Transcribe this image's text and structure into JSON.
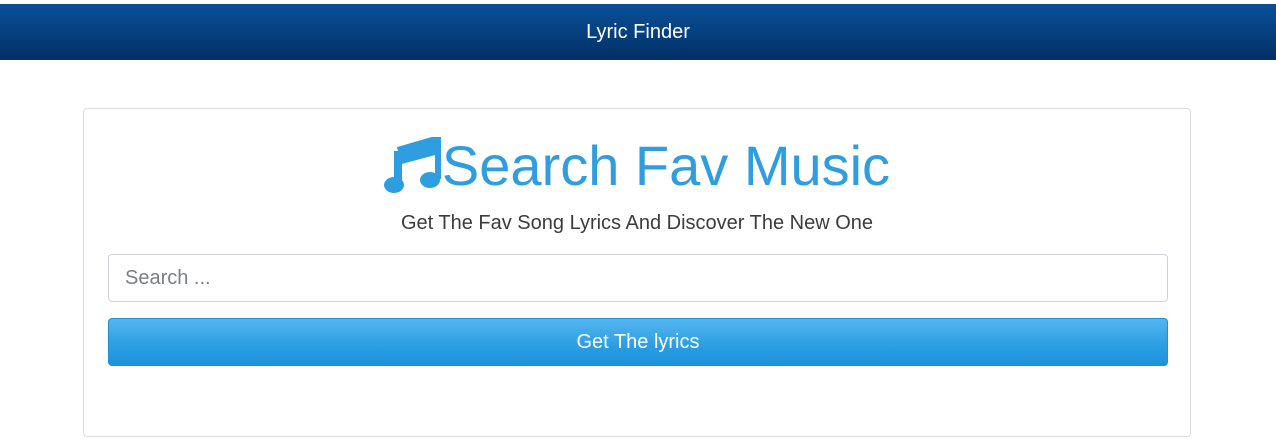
{
  "navbar": {
    "brand": "Lyric Finder"
  },
  "hero": {
    "icon": "music-note-icon",
    "title": "Search Fav Music",
    "subtitle": "Get The Fav Song Lyrics And Discover The New One"
  },
  "search": {
    "value": "",
    "placeholder": "Search ..."
  },
  "button": {
    "label": "Get The lyrics"
  },
  "colors": {
    "navbar": "#053f7e",
    "accent": "#2e9ee0",
    "button": "#2a9de3",
    "subtitle": "#3c3c3c"
  }
}
